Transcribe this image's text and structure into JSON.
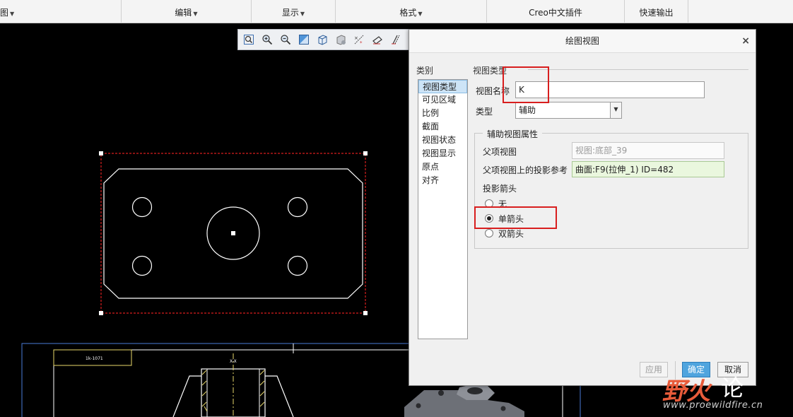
{
  "menubar": {
    "items": [
      {
        "label": "图",
        "caret": "▼"
      },
      {
        "label": "编辑",
        "caret": "▼"
      },
      {
        "label": "显示",
        "caret": "▼"
      },
      {
        "label": "格式",
        "caret": "▼"
      },
      {
        "label": "Creo中文插件",
        "caret": ""
      },
      {
        "label": "快速输出",
        "caret": ""
      }
    ]
  },
  "graphics_toolbar": {
    "icons": [
      "zoom-fit-icon",
      "zoom-in-icon",
      "zoom-out-icon",
      "repaint-icon",
      "display-style-icon",
      "view-manager-icon",
      "datum-display-icon",
      "annotation-display-icon",
      "sketch-display-icon"
    ]
  },
  "drawing": {
    "line_color": "#ffffff",
    "selection_color": "#d81e1e",
    "frame_color": "#4a7bd8",
    "title_note": "1k-1071",
    "section_label": "X-X"
  },
  "dialog": {
    "title": "绘图视图",
    "close": "×",
    "category_label": "类别",
    "categories": [
      "视图类型",
      "可见区域",
      "比例",
      "截面",
      "视图状态",
      "视图显示",
      "原点",
      "对齐"
    ],
    "selected_category": "视图类型",
    "section_title": "视图类型",
    "view_name_label": "视图名称",
    "view_name_value": "K",
    "type_label": "类型",
    "type_value": "辅助",
    "type_caret": "▼",
    "aux_group_title": "辅助视图属性",
    "parent_view_label": "父项视图",
    "parent_view_value": "视图:底部_39",
    "projection_ref_label": "父项视图上的投影参考",
    "projection_ref_value": "曲面:F9(拉伸_1) ID=482",
    "arrow_label": "投影箭头",
    "arrow_options": [
      "无",
      "单箭头",
      "双箭头"
    ],
    "arrow_selected": "单箭头",
    "buttons": {
      "apply": "应用",
      "ok": "确定",
      "cancel": "取消"
    },
    "highlight_color": "#d81e1e"
  },
  "watermark": {
    "logo_a": "野火",
    "logo_b": "论",
    "url": "www.proewildfire.cn"
  }
}
